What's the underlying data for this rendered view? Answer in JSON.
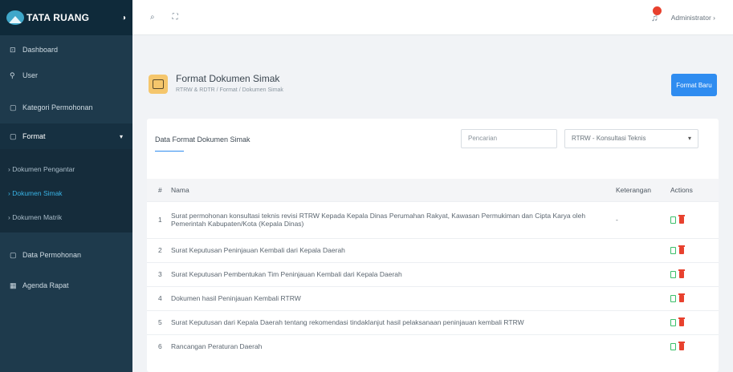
{
  "brand": {
    "name": "TATA RUANG"
  },
  "sidebar": {
    "items": [
      {
        "label": "Dashboard",
        "icon": "dashboard-icon"
      },
      {
        "label": "User",
        "icon": "user-icon"
      },
      {
        "label": "Kategori Permohonan",
        "icon": "category-icon"
      },
      {
        "label": "Format",
        "icon": "document-icon"
      }
    ],
    "sub_items": [
      {
        "label": "Dokumen Pengantar"
      },
      {
        "label": "Dokumen Simak"
      },
      {
        "label": "Dokumen Matrik"
      }
    ],
    "bottom_items": [
      {
        "label": "Data Permohonan",
        "icon": "document-icon"
      },
      {
        "label": "Agenda Rapat",
        "icon": "calendar-icon"
      }
    ]
  },
  "topbar": {
    "user": "Administrator"
  },
  "page": {
    "title": "Format Dokumen Simak",
    "breadcrumb": "RTRW & RDTR  /  Format  /  Dokumen Simak",
    "new_button": "Format Baru"
  },
  "card": {
    "title": "Data Format Dokumen Simak",
    "search_placeholder": "Pencarian",
    "filter_value": "RTRW - Konsultasi Teknis"
  },
  "table": {
    "headers": {
      "no": "#",
      "nama": "Nama",
      "keterangan": "Keterangan",
      "actions": "Actions"
    },
    "rows": [
      {
        "no": "1",
        "nama": "Surat permohonan konsultasi teknis revisi RTRW Kepada Kepala Dinas Perumahan Rakyat, Kawasan Permukiman dan Cipta Karya oleh Pemerintah Kabupaten/Kota (Kepala Dinas)",
        "keterangan": "-"
      },
      {
        "no": "2",
        "nama": "Surat Keputusan Peninjauan Kembali dari Kepala Daerah",
        "keterangan": ""
      },
      {
        "no": "3",
        "nama": "Surat Keputusan Pembentukan Tim Peninjauan Kembali dari Kepala Daerah",
        "keterangan": ""
      },
      {
        "no": "4",
        "nama": "Dokumen hasil Peninjauan Kembali RTRW",
        "keterangan": ""
      },
      {
        "no": "5",
        "nama": "Surat Keputusan dari Kepala Daerah tentang rekomendasi tindaklanjut hasil pelaksanaan peninjauan kembali RTRW",
        "keterangan": ""
      },
      {
        "no": "6",
        "nama": "Rancangan Peraturan Daerah",
        "keterangan": ""
      }
    ]
  },
  "colors": {
    "sidebar": "#1e3a4c",
    "primary": "#2f8cf0",
    "edit": "#3bbf6a",
    "delete": "#e8412e"
  }
}
